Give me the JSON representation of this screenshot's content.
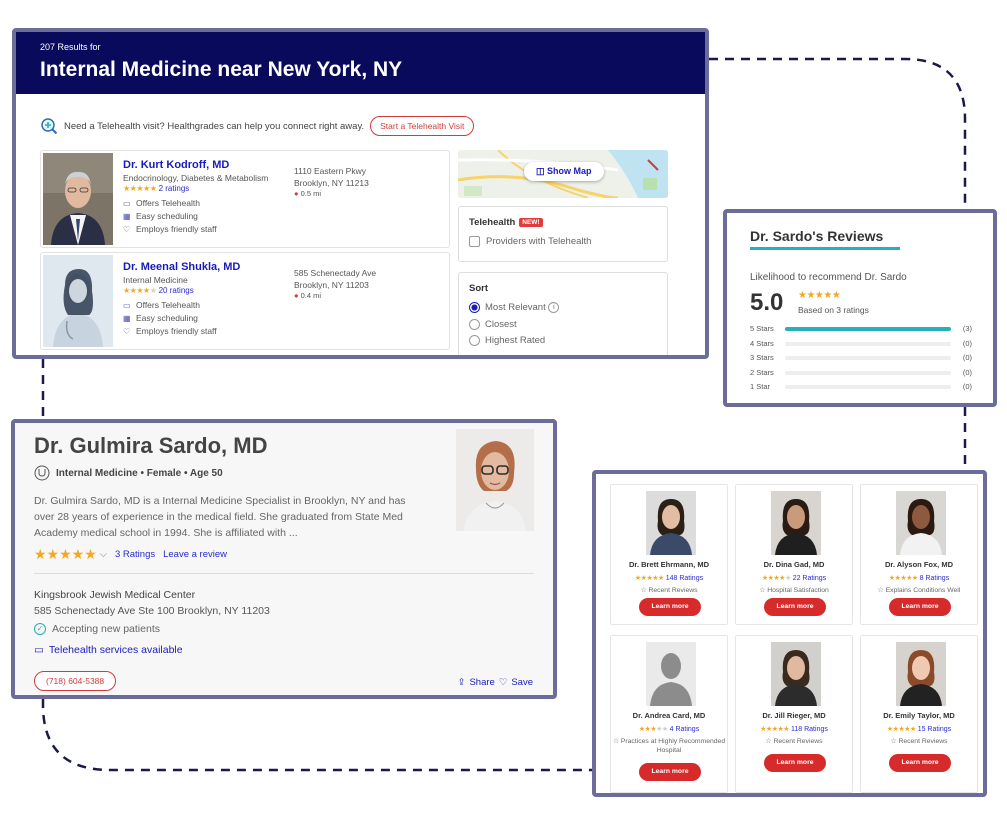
{
  "search": {
    "result_count": "207 Results for",
    "title": "Internal Medicine near New York, NY",
    "telehealth_prompt": "Need a Telehealth visit? Healthgrades can help you connect right away.",
    "telehealth_button": "Start a Telehealth Visit",
    "show_map": "Show Map",
    "filters": {
      "telehealth_heading": "Telehealth",
      "new_badge": "NEW!",
      "telehealth_option": "Providers with Telehealth",
      "sort_heading": "Sort",
      "sort_options": [
        "Most Relevant",
        "Closest",
        "Highest Rated"
      ],
      "sort_selected": "Most Relevant"
    },
    "results": [
      {
        "name": "Dr. Kurt Kodroff, MD",
        "specialty": "Endocrinology, Diabetes & Metabolism",
        "ratings": "2 ratings",
        "stars": 5,
        "features": [
          "Offers Telehealth",
          "Easy scheduling",
          "Employs friendly staff"
        ],
        "address_line1": "1110 Eastern Pkwy",
        "address_line2": "Brooklyn, NY 11213",
        "distance": "0.5 mi"
      },
      {
        "name": "Dr. Meenal Shukla, MD",
        "specialty": "Internal Medicine",
        "ratings": "20 ratings",
        "stars": 4,
        "features": [
          "Offers Telehealth",
          "Easy scheduling",
          "Employs friendly staff"
        ],
        "address_line1": "585 Schenectady Ave",
        "address_line2": "Brooklyn, NY 11203",
        "distance": "0.4 mi"
      }
    ]
  },
  "reviews": {
    "title": "Dr. Sardo's Reviews",
    "likelihood": "Likelihood to recommend Dr. Sardo",
    "score": "5.0",
    "based_on": "Based on 3 ratings",
    "breakdown": [
      {
        "label": "5 Stars",
        "count": "(3)",
        "fraction": 1.0
      },
      {
        "label": "4 Stars",
        "count": "(0)",
        "fraction": 0
      },
      {
        "label": "3 Stars",
        "count": "(0)",
        "fraction": 0
      },
      {
        "label": "2 Stars",
        "count": "(0)",
        "fraction": 0
      },
      {
        "label": "1 Star",
        "count": "(0)",
        "fraction": 0
      }
    ]
  },
  "profile": {
    "name": "Dr. Gulmira Sardo, MD",
    "subtitle": "Internal Medicine • Female • Age 50",
    "bio": "Dr. Gulmira Sardo, MD is a Internal Medicine Specialist in Brooklyn, NY and has over 28 years of experience in the medical field.  She graduated from State Med Academy medical school in 1994.  She is affiliated with ...",
    "ratings_link": "3 Ratings",
    "leave_review": "Leave a review",
    "hospital": "Kingsbrook Jewish Medical Center",
    "address": "585 Schenectady Ave Ste 100 Brooklyn, NY 11203",
    "accepting": "Accepting new patients",
    "telehealth": "Telehealth services available",
    "phone": "(718) 604-5388",
    "share": "Share",
    "save": "Save"
  },
  "similar": [
    {
      "name": "Dr. Brett Ehrmann, MD",
      "ratings": "148 Ratings",
      "stars": 5,
      "note": "Recent Reviews",
      "cta": "Learn more"
    },
    {
      "name": "Dr. Dina Gad, MD",
      "ratings": "22 Ratings",
      "stars": 4,
      "note": "Hospital Satisfaction",
      "cta": "Learn more"
    },
    {
      "name": "Dr. Alyson Fox, MD",
      "ratings": "8 Ratings",
      "stars": 5,
      "note": "Explains Conditions Well",
      "cta": "Learn more"
    },
    {
      "name": "Dr. Andrea Card, MD",
      "ratings": "4 Ratings",
      "stars": 3,
      "note": "Practices at Highly Recommended Hospital",
      "cta": "Learn more"
    },
    {
      "name": "Dr. Jill Rieger, MD",
      "ratings": "118 Ratings",
      "stars": 5,
      "note": "Recent Reviews",
      "cta": "Learn more"
    },
    {
      "name": "Dr. Emily Taylor, MD",
      "ratings": "15 Ratings",
      "stars": 5,
      "note": "Recent Reviews",
      "cta": "Learn more"
    }
  ],
  "colors": {
    "brand_navy": "#0a0a5c",
    "accent_red": "#d72b2b",
    "teal": "#26b0b8",
    "frame": "#6b6c99",
    "star": "#f5a623"
  }
}
